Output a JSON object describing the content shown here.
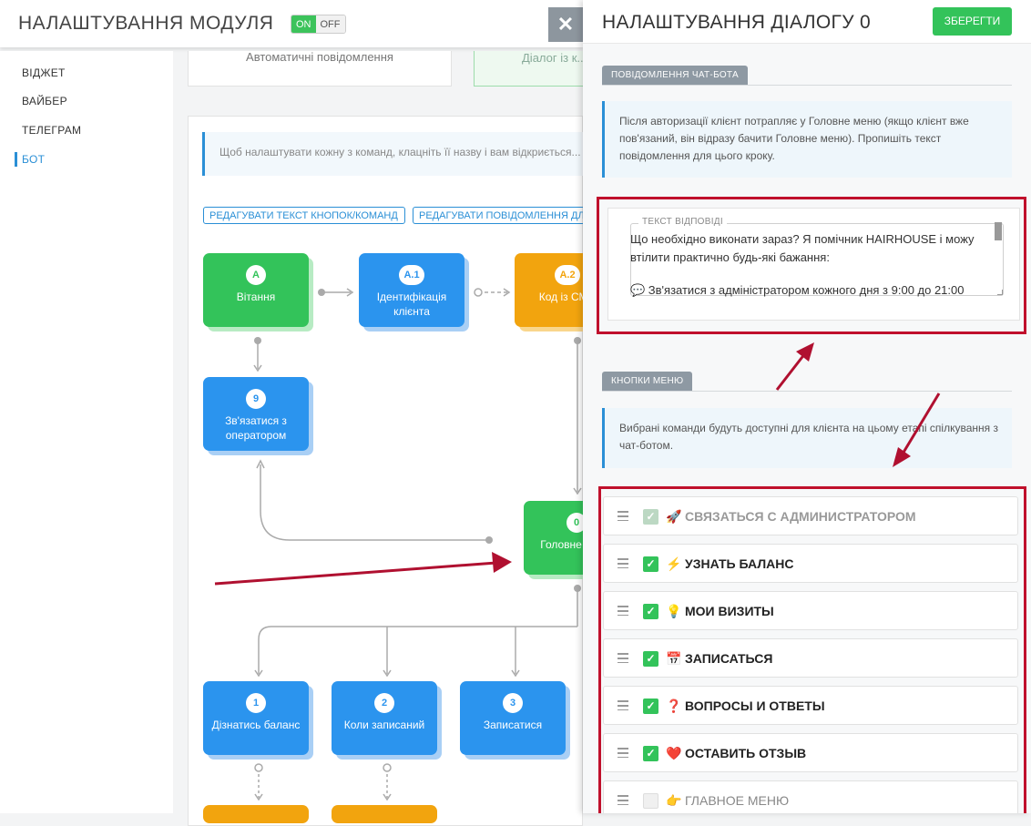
{
  "module": {
    "title": "НАЛАШТУВАННЯ МОДУЛЯ",
    "toggle_on": "ON",
    "toggle_off": "OFF",
    "close_icon": "✕"
  },
  "sidebar": {
    "items": [
      {
        "label": "ВІДЖЕТ"
      },
      {
        "label": "ВАЙБЕР"
      },
      {
        "label": "ТЕЛЕГРАМ"
      },
      {
        "label": "БОТ",
        "active": true
      }
    ]
  },
  "tabs": [
    {
      "label": "Автоматичні повідомлення"
    },
    {
      "label": "Діалог із к..."
    }
  ],
  "main": {
    "info": "Щоб налаштувати кожну з команд, клацніть її назву і вам відкриється...",
    "edit_buttons_label": "РЕДАГУВАТИ ТЕКСТ КНОПОК/КОМАНД",
    "edit_messages_label": "РЕДАГУВАТИ ПОВІДОМЛЕННЯ ДЛЯ..."
  },
  "flow": {
    "nodes": [
      {
        "badge": "A",
        "label": "Вітання",
        "color": "green"
      },
      {
        "badge": "A.1",
        "label": "Ідентифікація клієнта",
        "color": "blue"
      },
      {
        "badge": "A.2",
        "label": "Код із СМС",
        "color": "orange"
      },
      {
        "badge": "9",
        "label": "Зв'язатися з оператором",
        "color": "blue"
      },
      {
        "badge": "0",
        "label": "Головне меню",
        "color": "green"
      },
      {
        "badge": "1",
        "label": "Дізнатись баланс",
        "color": "blue"
      },
      {
        "badge": "2",
        "label": "Коли записаний",
        "color": "blue"
      },
      {
        "badge": "3",
        "label": "Записатися",
        "color": "blue"
      }
    ]
  },
  "panel": {
    "title": "НАЛАШТУВАННЯ ДІАЛОГУ 0",
    "save_label": "ЗБЕРЕГТИ",
    "section1_label": "ПОВІДОМЛЕННЯ ЧАТ-БОТА",
    "section1_info": "Після авторизації клієнт потрапляє у Головне меню (якщо клієнт вже пов'язаний, він відразу бачити Головне меню). Пропишіть текст повідомлення для цього кроку.",
    "field_legend": "ТЕКСТ ВІДПОВІДІ",
    "field_line1": "Що необхідно виконати зараз? Я помічник HAIRHOUSE і можу втілити практично будь-які бажання:",
    "field_line2": "💬 Зв'язатися з адміністратором кожного дня з 9:00 до 21:00",
    "section2_label": "КНОПКИ МЕНЮ",
    "section2_info": "Вибрані команди будуть доступні для клієнта на цьому етапі спілкування з чат-ботом.",
    "menu_items": [
      {
        "icon": "🚀",
        "label": "СВЯЗАТЬСЯ С АДМИНИСТРАТОРОМ",
        "state": "disabled-checked"
      },
      {
        "icon": "⚡",
        "label": "УЗНАТЬ БАЛАНС",
        "state": "checked"
      },
      {
        "icon": "💡",
        "label": "МОИ ВИЗИТЫ",
        "state": "checked"
      },
      {
        "icon": "📅",
        "label": "ЗАПИСАТЬСЯ",
        "state": "checked"
      },
      {
        "icon": "❓",
        "label": "ВОПРОСЫ И ОТВЕТЫ",
        "state": "checked"
      },
      {
        "icon": "❤️",
        "label": "ОСТАВИТЬ ОТЗЫВ",
        "state": "checked"
      },
      {
        "icon": "👉",
        "label": "ГЛАВНОЕ МЕНЮ",
        "state": "unchecked"
      }
    ],
    "check_glyph": "✓"
  },
  "colors": {
    "green": "#33c35a",
    "blue": "#2b94ee",
    "orange": "#f2a40e",
    "annotation_red": "#c0102c",
    "link_blue": "#2a8fd6"
  }
}
